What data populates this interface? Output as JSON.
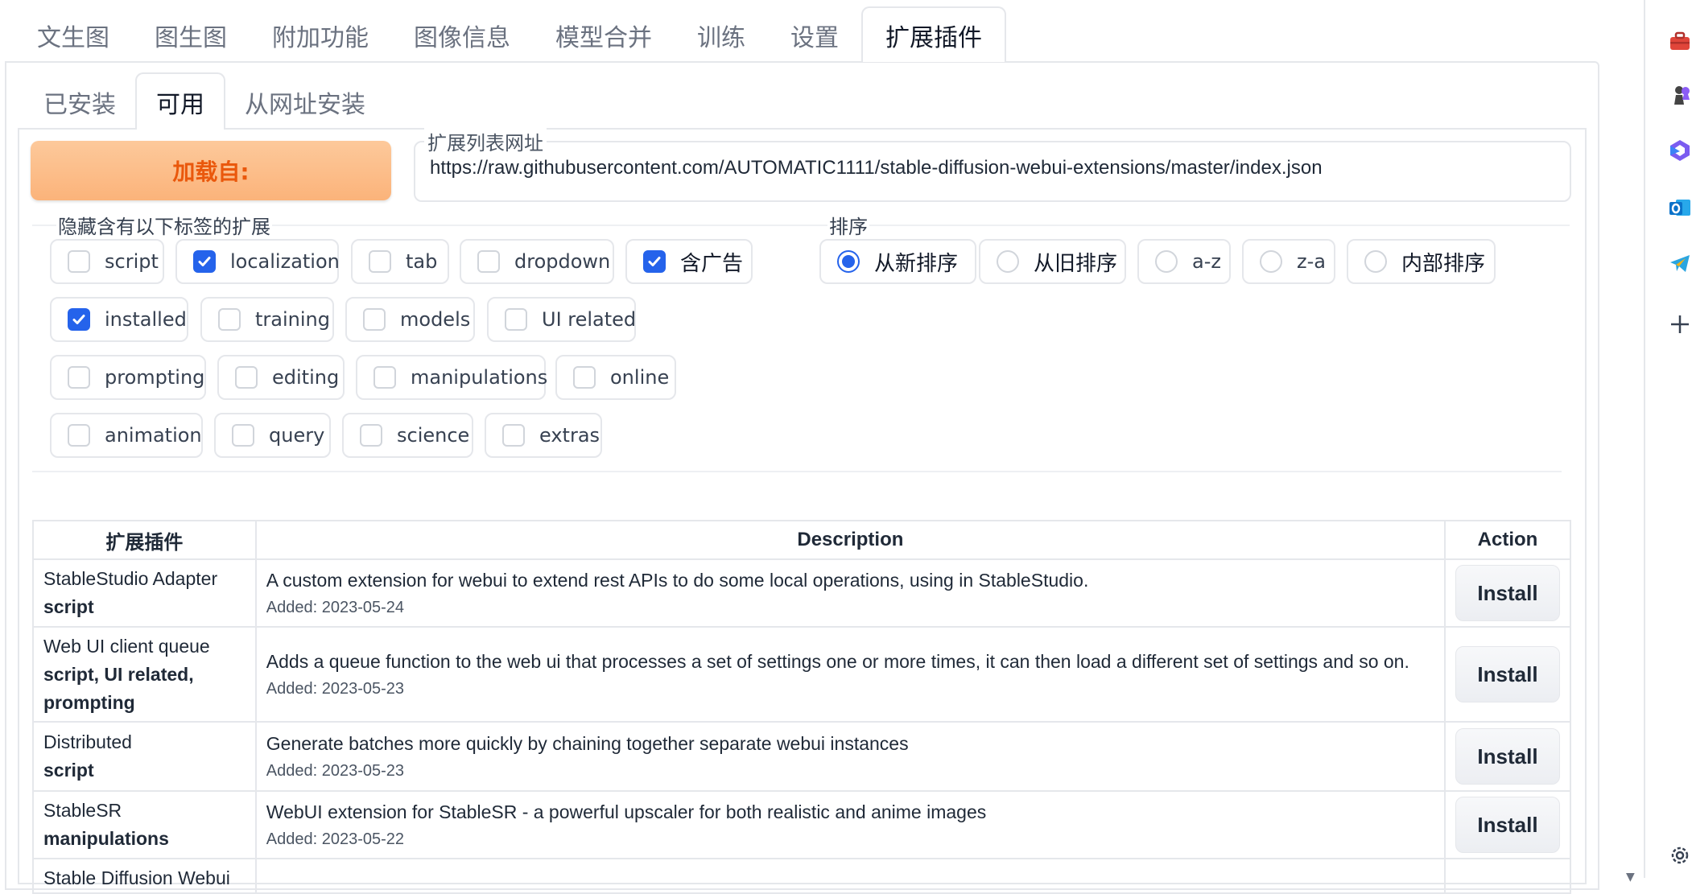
{
  "top_tabs": [
    "文生图",
    "图生图",
    "附加功能",
    "图像信息",
    "模型合并",
    "训练",
    "设置",
    "扩展插件"
  ],
  "sub_tabs": [
    "已安装",
    "可用",
    "从网址安装"
  ],
  "load_button": "加载自:",
  "url_field": {
    "label": "扩展列表网址",
    "value": "https://raw.githubusercontent.com/AUTOMATIC1111/stable-diffusion-webui-extensions/master/index.json"
  },
  "hide_group": {
    "label": "隐藏含有以下标签的扩展",
    "tags": [
      {
        "label": "script",
        "checked": false
      },
      {
        "label": "localization",
        "checked": true
      },
      {
        "label": "tab",
        "checked": false
      },
      {
        "label": "dropdown",
        "checked": false
      },
      {
        "label": "含广告",
        "checked": true
      },
      {
        "label": "installed",
        "checked": true
      },
      {
        "label": "training",
        "checked": false
      },
      {
        "label": "models",
        "checked": false
      },
      {
        "label": "UI related",
        "checked": false
      },
      {
        "label": "prompting",
        "checked": false
      },
      {
        "label": "editing",
        "checked": false
      },
      {
        "label": "manipulations",
        "checked": false
      },
      {
        "label": "online",
        "checked": false
      },
      {
        "label": "animation",
        "checked": false
      },
      {
        "label": "query",
        "checked": false
      },
      {
        "label": "science",
        "checked": false
      },
      {
        "label": "extras",
        "checked": false
      }
    ]
  },
  "sort_group": {
    "label": "排序",
    "options": [
      {
        "label": "从新排序",
        "selected": true
      },
      {
        "label": "从旧排序",
        "selected": false
      },
      {
        "label": "a-z",
        "selected": false
      },
      {
        "label": "z-a",
        "selected": false
      },
      {
        "label": "内部排序",
        "selected": false
      }
    ]
  },
  "table": {
    "headers": [
      "扩展插件",
      "Description",
      "Action"
    ],
    "rows": [
      {
        "name": "StableStudio Adapter",
        "tags": "script",
        "description": "A custom extension for webui to extend rest APIs to do some local operations, using in StableStudio.",
        "added": "Added: 2023-05-24",
        "action": "Install"
      },
      {
        "name": "Web UI client queue",
        "tags": "script, UI related, prompting",
        "description": "Adds a queue function to the web ui that processes a set of settings one or more times, it can then load a different set of settings and so on.",
        "added": "Added: 2023-05-23",
        "action": "Install"
      },
      {
        "name": "Distributed",
        "tags": "script",
        "description": "Generate batches more quickly by chaining together separate webui instances",
        "added": "Added: 2023-05-23",
        "action": "Install"
      },
      {
        "name": "StableSR",
        "tags": "manipulations",
        "description": "WebUI extension for StableSR - a powerful upscaler for both realistic and anime images",
        "added": "Added: 2023-05-22",
        "action": "Install"
      },
      {
        "name": "Stable Diffusion Webui",
        "tags": "",
        "description": "",
        "added": "",
        "action": ""
      }
    ]
  },
  "browser_sidebar": {
    "icons": [
      "toolbox-icon",
      "chess-pawn-icon",
      "copilot-icon",
      "outlook-icon",
      "telegram-icon",
      "plus-icon",
      "gear-icon"
    ],
    "colors": {
      "toolbox": "#e0453a",
      "copilot": "#7b5cf0",
      "outlook": "#0a72c9",
      "telegram": "#2aa5e0"
    }
  },
  "colors": {
    "accent": "#2563eb",
    "load_button_text": "#ea580c",
    "load_button_bg": "#fbb37a"
  }
}
